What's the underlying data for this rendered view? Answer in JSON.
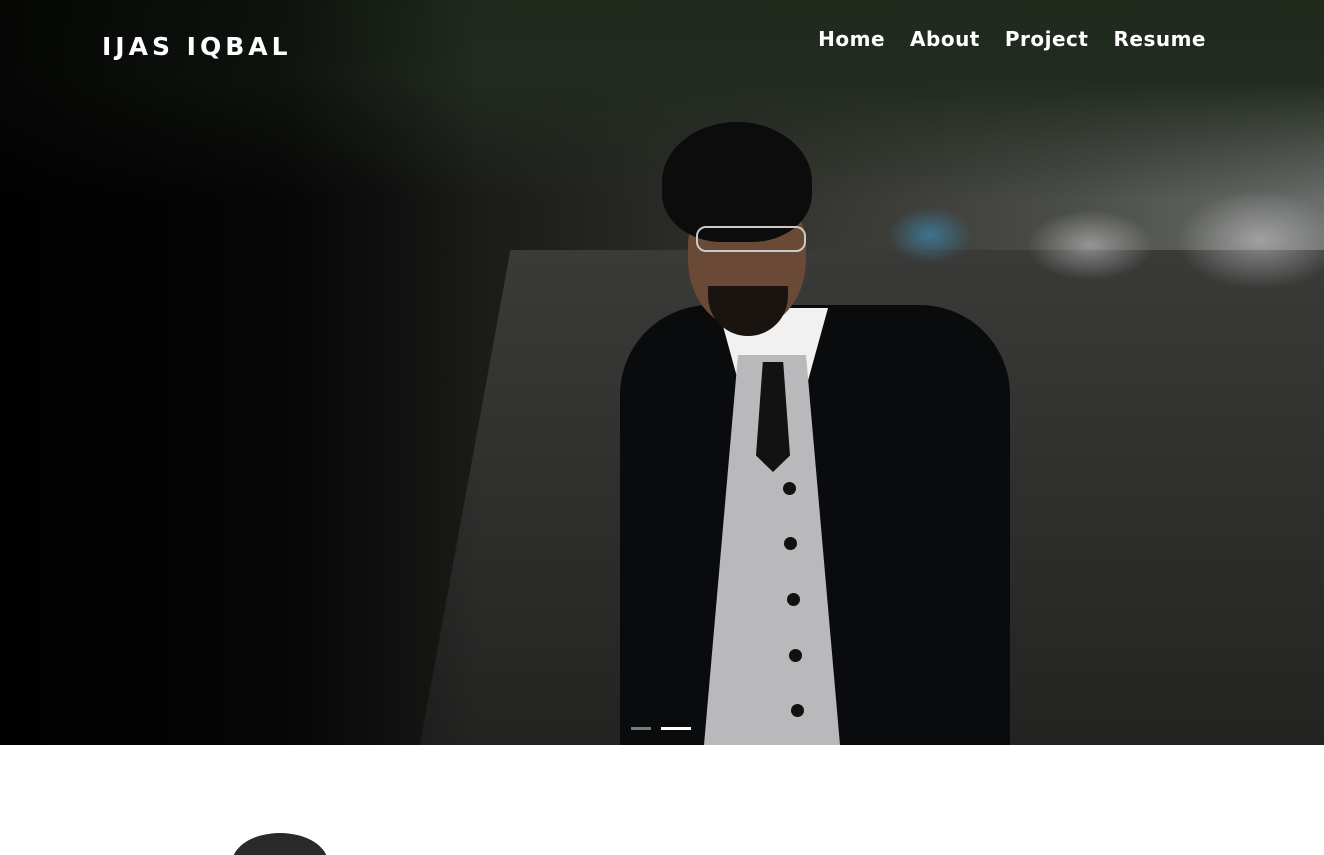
{
  "header": {
    "brand": "IJAS IQBAL",
    "nav": [
      "Home",
      "About",
      "Project",
      "Resume"
    ]
  },
  "hero": {
    "slide_count": 2,
    "active_slide": 2
  },
  "colors": {
    "nav_text": "#ffffff",
    "background": "#ffffff",
    "indicator_active": "#ffffff"
  }
}
